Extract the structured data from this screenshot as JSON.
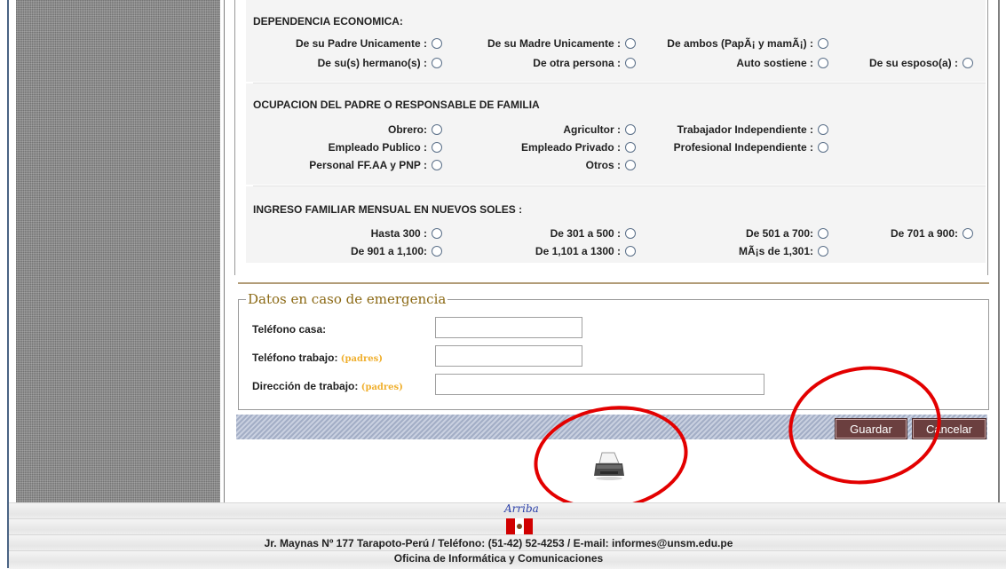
{
  "economic": {
    "title": "DEPENDENCIA ECONOMICA:",
    "options": [
      "De su Padre Unicamente :",
      "De su Madre Unicamente :",
      "De ambos (PapÃ¡ y mamÃ¡) :",
      "De su(s) hermano(s) :",
      "De otra persona :",
      "Auto sostiene :",
      "De su esposo(a) :"
    ]
  },
  "occupation": {
    "title": "OCUPACION DEL PADRE O RESPONSABLE DE FAMILIA",
    "options": [
      "Obrero:",
      "Agricultor :",
      "Trabajador Independiente :",
      "Empleado Publico :",
      "Empleado Privado :",
      "Profesional Independiente :",
      "Personal FF.AA y PNP :",
      "Otros :"
    ]
  },
  "income": {
    "title": "INGRESO FAMILIAR MENSUAL EN NUEVOS SOLES :",
    "options": [
      "Hasta 300 :",
      "De 301 a 500 :",
      "De 501 a 700:",
      "De 701 a 900:",
      "De 901 a 1,100:",
      "De 1,101 a 1300 :",
      "MÃ¡s de 1,301:"
    ]
  },
  "emergency": {
    "legend": "Datos en caso de emergencia",
    "home_phone_label": "Teléfono casa:",
    "work_phone_label": "Teléfono trabajo:",
    "work_address_label": "Dirección de trabajo:",
    "hint": "(padres)",
    "home_phone_value": "",
    "work_phone_value": "",
    "work_address_value": ""
  },
  "buttons": {
    "save": "Guardar",
    "cancel": "Cancelar"
  },
  "footer": {
    "top_link": "Arriba",
    "address": "Jr. Maynas Nº 177 Tarapoto-Perú / Teléfono: (51-42) 52-4253 / E-mail: informes@unsm.edu.pe",
    "office": "Oficina de Informática y Comunicaciones"
  },
  "icons": {
    "printer": "printer-icon",
    "flag": "peru-flag-icon"
  },
  "colors": {
    "legend": "#8b6914",
    "hint": "#f0b030",
    "button_bg": "#6b3f3f",
    "annotation": "#e30000"
  }
}
